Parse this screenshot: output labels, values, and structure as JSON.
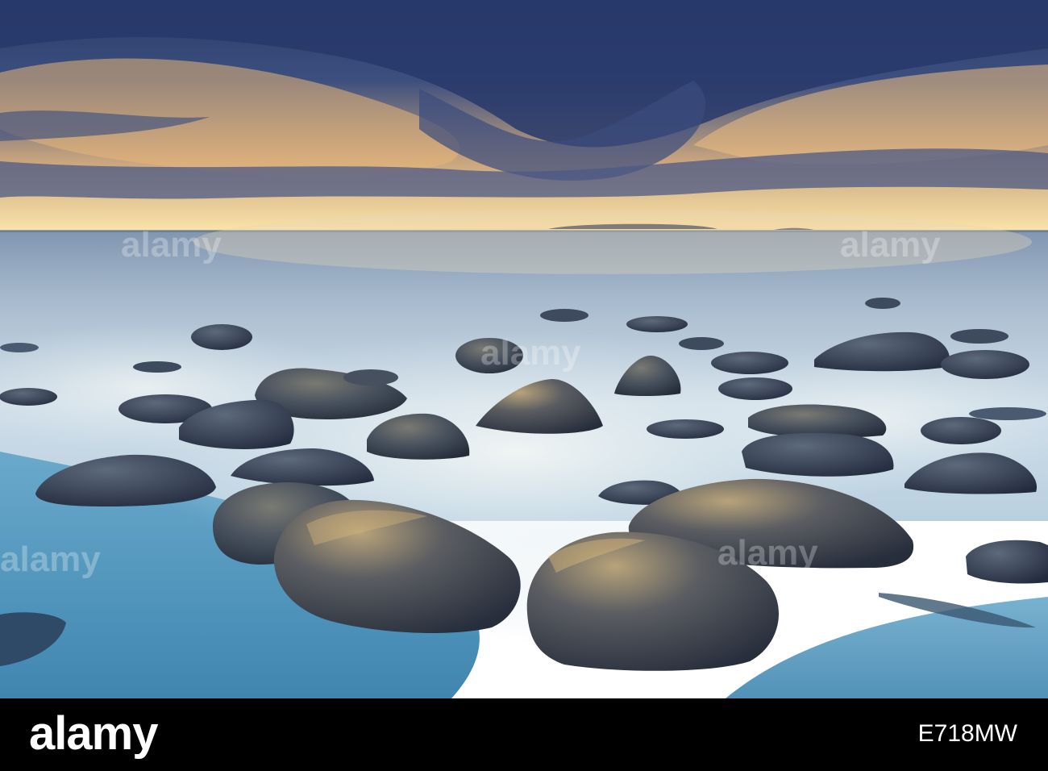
{
  "watermark": {
    "brand": "alamy",
    "image_id": "E718MW"
  },
  "colors": {
    "sky_dark": "#2c3f6e",
    "sky_glow": "#f6cf88",
    "sea": "#9fb6cc",
    "mist": "#d8e6ef",
    "sand": "#4f93b9",
    "rock": "#3a4658",
    "footer": "#000000"
  }
}
